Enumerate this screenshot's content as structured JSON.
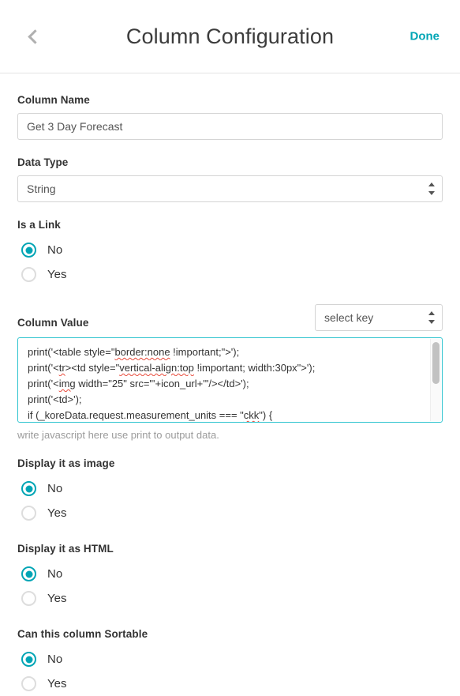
{
  "header": {
    "back_icon": "chevron-left-icon",
    "title": "Column Configuration",
    "done_label": "Done"
  },
  "form": {
    "column_name": {
      "label": "Column Name",
      "value": "Get 3 Day Forecast",
      "placeholder": ""
    },
    "data_type": {
      "label": "Data Type",
      "selected": "String"
    },
    "is_a_link": {
      "label": "Is a Link",
      "options": [
        "No",
        "Yes"
      ],
      "selected": "No"
    },
    "column_value": {
      "label": "Column Value",
      "select_key": {
        "selected": "select key"
      },
      "code_lines": [
        "print('<table style=\"border:none !important;\">');",
        "print('<tr><td style=\"vertical-align:top !important; width:30px\">');",
        "print('<img width=\"25\" src=\"'+icon_url+'\"/></td>');",
        "print('<td>');",
        "if (_koreData.request.measurement_units === \"ckk\") {"
      ],
      "helper_text": "write javascript here use print to output data."
    },
    "display_as_image": {
      "label": "Display it as image",
      "options": [
        "No",
        "Yes"
      ],
      "selected": "No"
    },
    "display_as_html": {
      "label": "Display it as HTML",
      "options": [
        "No",
        "Yes"
      ],
      "selected": "No"
    },
    "sortable": {
      "label": "Can this column Sortable",
      "options": [
        "No",
        "Yes"
      ],
      "selected": "No"
    }
  },
  "colors": {
    "accent": "#00a5b5",
    "focus_border": "#2ec4cf",
    "text": "#333333",
    "muted": "#9b9b9b"
  }
}
